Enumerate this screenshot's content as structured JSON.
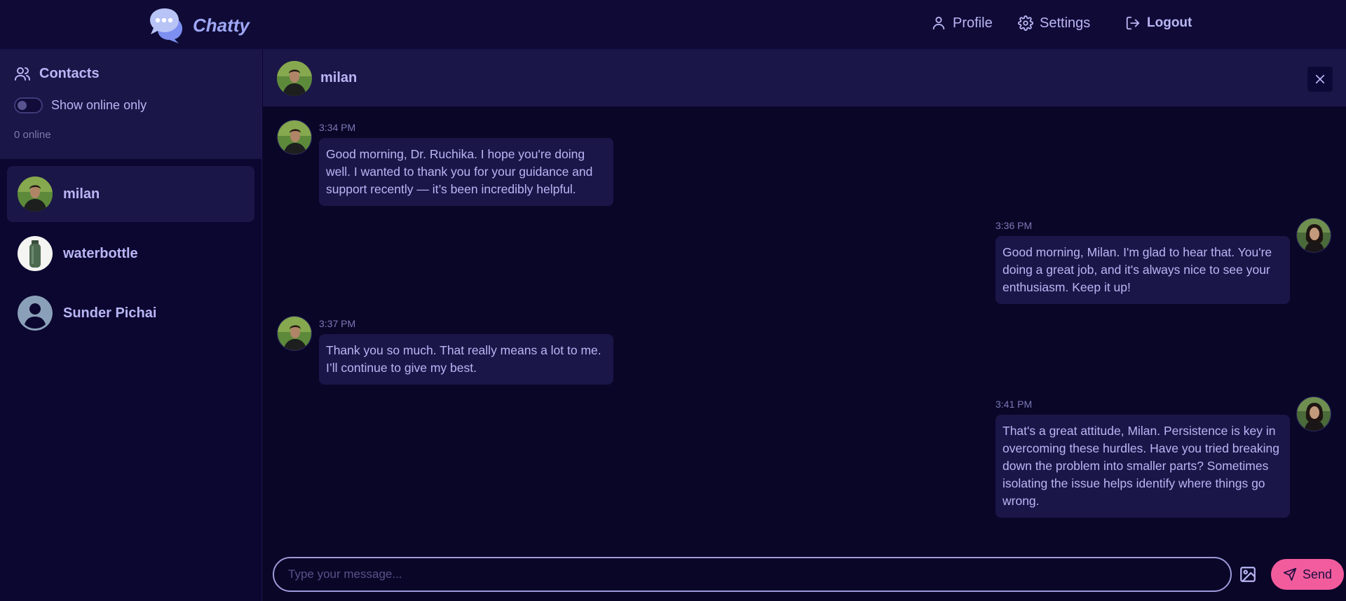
{
  "app": {
    "name": "Chatty"
  },
  "nav": {
    "profile": "Profile",
    "settings": "Settings",
    "logout": "Logout"
  },
  "sidebar": {
    "title": "Contacts",
    "toggle_label": "Show online only",
    "online_count": "0 online",
    "contacts": [
      {
        "name": "milan",
        "active": true
      },
      {
        "name": "waterbottle",
        "active": false
      },
      {
        "name": "Sunder Pichai",
        "active": false
      }
    ]
  },
  "chat": {
    "header_name": "milan",
    "messages": [
      {
        "time": "3:34 PM",
        "side": "left",
        "text": "Good morning, Dr. Ruchika. I hope you're doing well. I wanted to thank you for your guidance and support recently — it’s been incredibly helpful."
      },
      {
        "time": "3:36 PM",
        "side": "right",
        "text": "Good morning, Milan. I'm glad to hear that. You're doing a great job, and it's always nice to see your enthusiasm. Keep it up!"
      },
      {
        "time": "3:37 PM",
        "side": "left",
        "text": "Thank you so much. That really means a lot to me. I’ll continue to give my best."
      },
      {
        "time": "3:41 PM",
        "side": "right",
        "text": "That's a great attitude, Milan. Persistence is key in overcoming these hurdles. Have you tried breaking down the problem into smaller parts? Sometimes isolating the issue helps identify where things go wrong."
      }
    ]
  },
  "composer": {
    "placeholder": "Type your message...",
    "send_label": "Send"
  },
  "colors": {
    "background": "#0a0628",
    "panel": "#1b1648",
    "accent": "#f25c9d",
    "text": "#b9b6f5"
  }
}
